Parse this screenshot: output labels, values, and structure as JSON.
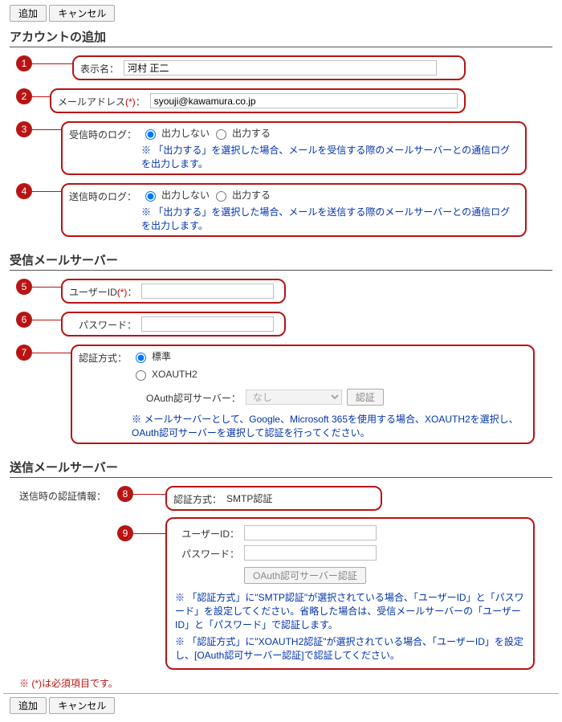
{
  "buttons": {
    "add": "追加",
    "cancel": "キャンセル",
    "auth": "認証",
    "oauth_auth": "OAuth認可サーバー認証"
  },
  "sections": {
    "account": "アカウントの追加",
    "recv": "受信メールサーバー",
    "send": "送信メールサーバー"
  },
  "badges": [
    "1",
    "2",
    "3",
    "4",
    "5",
    "6",
    "7",
    "8",
    "9"
  ],
  "labels": {
    "display_name": "表示名：",
    "email": "メールアドレス",
    "email_req": "(*)",
    "email_colon": "：",
    "recv_log": "受信時のログ：",
    "send_log": "送信時のログ：",
    "user_id": "ユーザーID",
    "user_id_req": "(*)",
    "user_id_colon": "：",
    "password": "パスワード：",
    "auth_method": "認証方式：",
    "oauth_server": "OAuth認可サーバー：",
    "send_auth_info": "送信時の認証情報：",
    "send_user_id": "ユーザーID：",
    "send_password": "パスワード："
  },
  "values": {
    "display_name": "河村 正二",
    "email": "syouji@kawamura.co.jp",
    "oauth_server_sel": "なし",
    "send_auth_method": "SMTP認証"
  },
  "radios": {
    "no_output": "出力しない",
    "output": "出力する",
    "standard": "標準",
    "xoauth2": "XOAUTH2"
  },
  "notes": {
    "recv_log": "※ 「出力する」を選択した場合、メールを受信する際のメールサーバーとの通信ログを出力します。",
    "send_log": "※ 「出力する」を選択した場合、メールを送信する際のメールサーバーとの通信ログを出力します。",
    "oauth": "※ メールサーバーとして、Google、Microsoft 365を使用する場合、XOAUTH2を選択し、OAuth認可サーバーを選択して認証を行ってください。",
    "smtp1": "※ 「認証方式」に\"SMTP認証\"が選択されている場合、「ユーザーID」と「パスワード」を設定してください。省略した場合は、受信メールサーバーの「ユーザーID」と「パスワード」で認証します。",
    "smtp2": "※ 「認証方式」に\"XOAUTH2認証\"が選択されている場合、「ユーザーID」を設定し、[OAuth認可サーバー認証]で認証してください。"
  },
  "footer": "※ (*)は必須項目です。"
}
